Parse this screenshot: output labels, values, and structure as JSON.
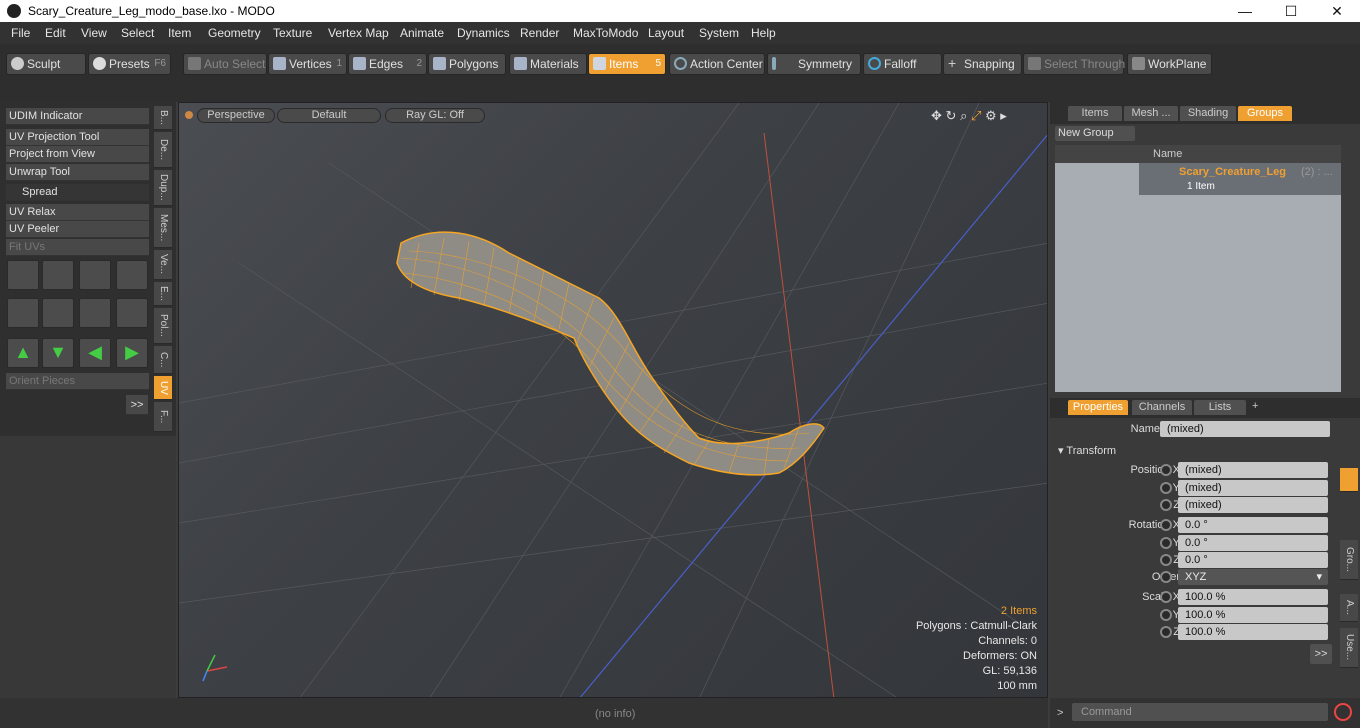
{
  "window": {
    "title": "Scary_Creature_Leg_modo_base.lxo - MODO",
    "min": "—",
    "max": "☐",
    "close": "✕"
  },
  "menu": [
    "File",
    "Edit",
    "View",
    "Select",
    "Item",
    "Geometry",
    "Texture",
    "Vertex Map",
    "Animate",
    "Dynamics",
    "Render",
    "MaxToModo",
    "Layout",
    "System",
    "Help"
  ],
  "toolbar": {
    "sculpt": "Sculpt",
    "presets": "Presets",
    "presets_key": "F6",
    "auto_select": "Auto Select",
    "vertices": "Vertices",
    "vertices_num": "1",
    "edges": "Edges",
    "edges_num": "2",
    "polygons": "Polygons",
    "materials": "Materials",
    "items": "Items",
    "items_num": "5",
    "action_center": "Action Center",
    "symmetry": "Symmetry",
    "falloff": "Falloff",
    "snapping": "Snapping",
    "select_through": "Select Through",
    "workplane": "WorkPlane"
  },
  "left_tools": {
    "udim": "UDIM Indicator",
    "uv_projection": "UV Projection Tool",
    "project_view": "Project from View",
    "unwrap": "Unwrap Tool",
    "spread": "Spread",
    "uv_relax": "UV Relax",
    "uv_peeler": "UV Peeler",
    "fit_uvs": "Fit UVs",
    "orient": "Orient Pieces",
    "more": ">>"
  },
  "vtabs": [
    "B...",
    "De...",
    "Dup...",
    "Mes...",
    "Ve...",
    "E...",
    "Pol...",
    "C...",
    "UV",
    "F..."
  ],
  "viewport": {
    "perspective": "Perspective",
    "default": "Default",
    "raygl": "Ray GL: Off",
    "hud_items": "2 Items",
    "hud_polygons": "Polygons : Catmull-Clark",
    "hud_channels": "Channels: 0",
    "hud_deformers": "Deformers: ON",
    "hud_gl": "GL: 59,136",
    "hud_scale": "100 mm"
  },
  "status": {
    "info": "(no info)",
    "prompt": ">",
    "command_placeholder": "Command"
  },
  "groups_panel": {
    "tabs": [
      "Items",
      "Mesh ...",
      "Shading",
      "Groups"
    ],
    "new_group": "New Group",
    "col_name": "Name",
    "group_name": "Scary_Creature_Leg",
    "group_count": "(2) : ...",
    "group_sub": "1 Item"
  },
  "props_panel": {
    "tabs": [
      "Properties",
      "Channels",
      "Lists"
    ],
    "add_tab": "+",
    "name_label": "Name",
    "name_value": "(mixed)",
    "transform": "Transform",
    "pos_label": "Position X",
    "pos_x": "(mixed)",
    "pos_y": "(mixed)",
    "pos_z": "(mixed)",
    "rot_label": "Rotation X",
    "rot_x": "0.0 °",
    "rot_y": "0.0 °",
    "rot_z": "0.0 °",
    "order_label": "Order",
    "order_value": "XYZ",
    "scale_label": "Scale X",
    "scale_x": "100.0 %",
    "scale_y": "100.0 %",
    "scale_z": "100.0 %",
    "y": "Y",
    "z": "Z",
    "more": ">>",
    "side_tabs": [
      "Gro...",
      "A...",
      "Use..."
    ]
  },
  "colors": {
    "accent": "#f0a030",
    "mesh": "#f5a623"
  }
}
